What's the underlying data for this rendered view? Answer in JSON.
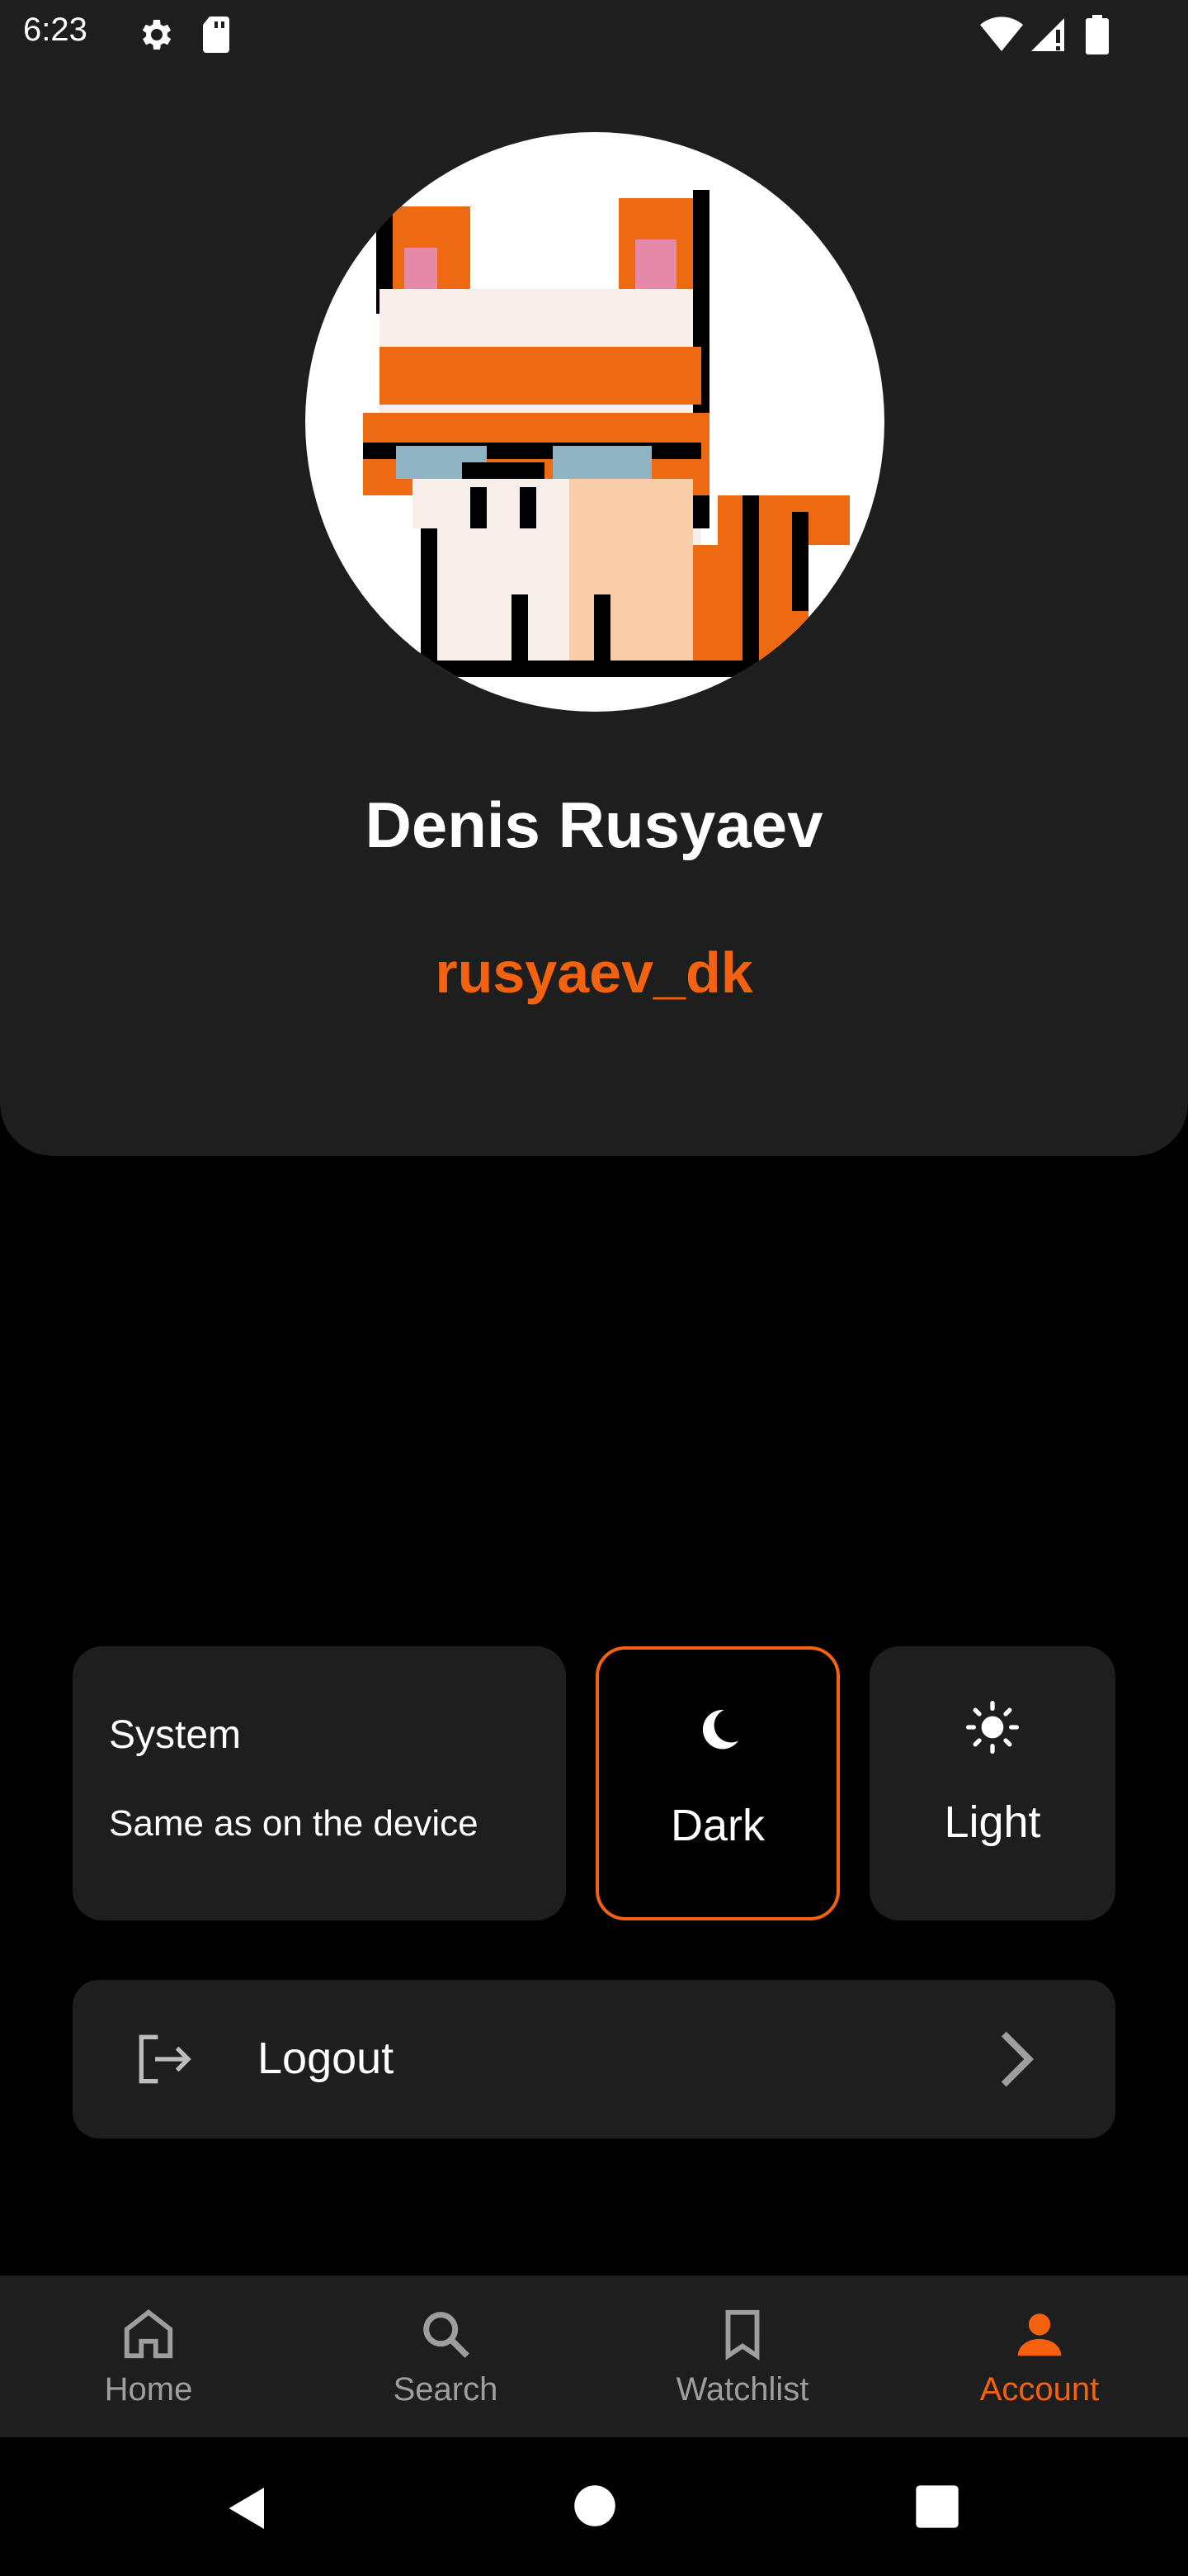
{
  "status_bar": {
    "time": "6:23",
    "icons": [
      "gear-icon",
      "sd-card-icon",
      "wifi-icon",
      "signal-icon",
      "battery-icon"
    ]
  },
  "profile": {
    "name": "Denis Rusyaev",
    "username": "rusyaev_dk",
    "avatar": "pixel-art-cat-avatar"
  },
  "theme_options": {
    "system": {
      "title": "System",
      "subtitle": "Same as on the device"
    },
    "dark": {
      "label": "Dark",
      "icon": "moon-icon",
      "selected": true
    },
    "light": {
      "label": "Light",
      "icon": "sun-icon"
    }
  },
  "logout": {
    "label": "Logout",
    "icon": "logout-icon"
  },
  "bottom_nav": {
    "items": [
      {
        "label": "Home",
        "icon": "home-icon"
      },
      {
        "label": "Search",
        "icon": "search-icon"
      },
      {
        "label": "Watchlist",
        "icon": "bookmark-icon"
      },
      {
        "label": "Account",
        "icon": "person-icon",
        "active": true
      }
    ]
  },
  "colors": {
    "accent": "#f5620f",
    "surface": "#1e1e1f",
    "background": "#000000",
    "inactive": "#9e9e9e"
  }
}
